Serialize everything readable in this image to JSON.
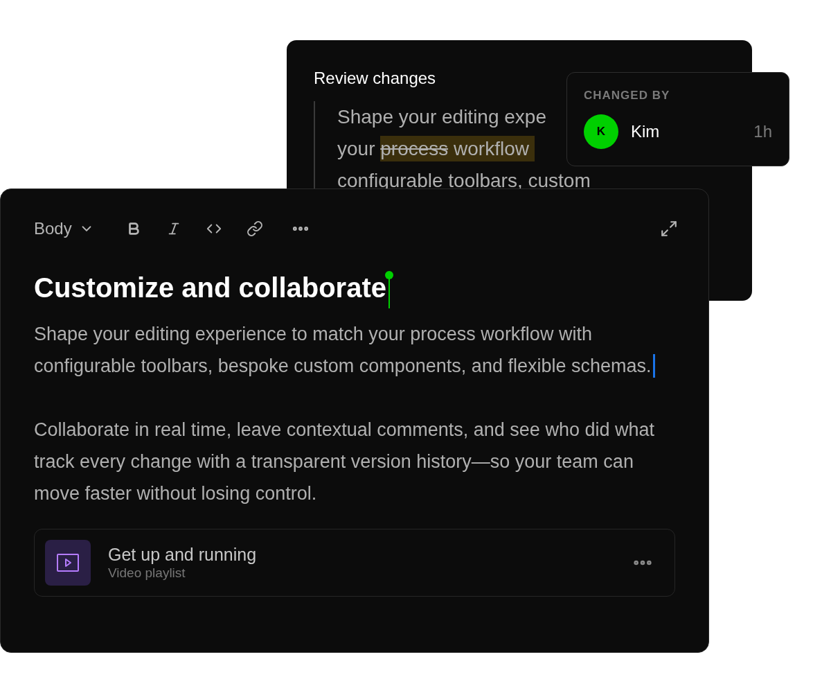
{
  "review": {
    "title": "Review changes",
    "lines": [
      {
        "segments": [
          {
            "kind": "plain",
            "text": "Shape your editing expe"
          }
        ]
      },
      {
        "segments": [
          {
            "kind": "plain",
            "text": "your "
          },
          {
            "kind": "deleted",
            "text": "process"
          },
          {
            "kind": "inserted",
            "text": " workflow"
          }
        ]
      },
      {
        "segments": [
          {
            "kind": "plain",
            "text": "configurable toolbars, custom"
          }
        ]
      }
    ]
  },
  "popover": {
    "heading": "CHANGED BY",
    "user": {
      "initial": "K",
      "name": "Kim",
      "time": "1h",
      "color": "#00d000"
    }
  },
  "editor": {
    "style_menu": "Body",
    "heading": "Customize and collaborate",
    "paragraphs": [
      "Shape your editing experience to match your process workflow with configurable toolbars, bespoke custom components, and flexible schemas.",
      "Collaborate in real time, leave contextual comments, and see who did what track every change with a transparent version history—so your team can move faster without losing control."
    ],
    "attachment": {
      "title": "Get up and running",
      "subtitle": "Video playlist"
    }
  }
}
